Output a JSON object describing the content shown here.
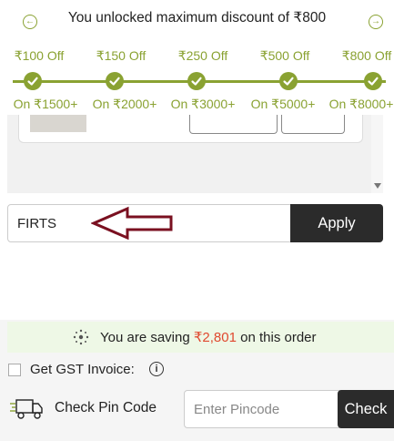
{
  "banner": {
    "title": "You unlocked maximum discount of ₹800",
    "prev_icon": "chevron-left-icon",
    "next_icon": "chevron-right-icon"
  },
  "tiers": [
    {
      "discount": "₹100 Off",
      "threshold": "On ₹1500+"
    },
    {
      "discount": "₹150 Off",
      "threshold": "On ₹2000+"
    },
    {
      "discount": "₹250 Off",
      "threshold": "On ₹3000+"
    },
    {
      "discount": "₹500 Off",
      "threshold": "On ₹5000+"
    },
    {
      "discount": "₹800 Off",
      "threshold": "On ₹8000+"
    }
  ],
  "coupon": {
    "value": "FIRTS",
    "apply_label": "Apply"
  },
  "savings": {
    "prefix": "You are saving ",
    "amount": "₹2,801",
    "suffix": " on this order"
  },
  "gst": {
    "label": "Get GST Invoice:",
    "checked": false
  },
  "pincode": {
    "label": "Check Pin Code",
    "placeholder": "Enter Pincode",
    "button_label": "Check"
  },
  "colors": {
    "accent_green": "#8aa232",
    "savings_red": "#e0492f",
    "annotation_arrow": "#7a1020",
    "button_dark": "#2b2b2b"
  }
}
